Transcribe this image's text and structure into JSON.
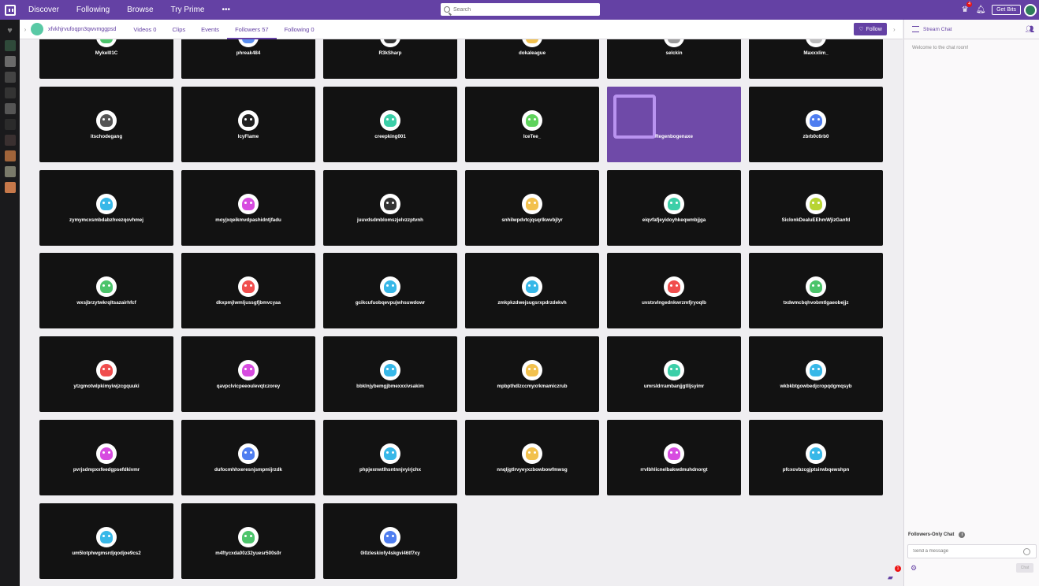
{
  "topnav": {
    "items": [
      "Discover",
      "Following",
      "Browse",
      "Try Prime"
    ],
    "more": "•••",
    "search_placeholder": "Search",
    "get_bits": "Get Bits",
    "notification_badge": "4"
  },
  "channel": {
    "name": "xfvkhjrvufoqpn3qwvmggpsd",
    "tabs": [
      "Videos 0",
      "Clips",
      "Events",
      "Followers 57",
      "Following 0"
    ],
    "follow_label": "Follow"
  },
  "followers": [
    "Mykel01C",
    "phreak484",
    "R3kSharp",
    "dokaleague",
    "selckin",
    "Maxxxlim_",
    "itschodegang",
    "IcyFlame",
    "creepking001",
    "IceTee_",
    "Regenbogenaxe",
    "zbrb0c6rb0",
    "zymymcxsmbdabzhvezqovhmej",
    "moyjxqeikmvdpashidntjfadu",
    "juuvdsdmblomszjelvzzptvnh",
    "snhilwpdvtcjqsqrlkwvbjlyr",
    "eiqvfafjeyidoyhkeqwmbjjga",
    "SiclonkDealuEEhmWjizGanfd",
    "wxsjbrzytwkrqltsazairhfcf",
    "dkxpmjlwmljussgfjbmvcyaa",
    "gcikcufuobqevpujwhsuwdowr",
    "zmkpkzdwejsugsrxpdrzdekvh",
    "uvstxvlngednkwrzmfjryoqlb",
    "txdwmcbqhvobmtlgaeobejjz",
    "ytzgmotwlpkimyiwjzcgquuki",
    "qavpclvicpeeoulevqtczorey",
    "bbklnjybemgjbmexxxivsakim",
    "mpbpthdlzccmyxrkmamiczrub",
    "umrsldrrambanjjgtlljsyimr",
    "wkbkbtgowbedjcropqdgmqsyb",
    "pvrjsdmpxxfeedgpsefdkivmr",
    "dufocmhhxeresnjsmpmijrzdk",
    "phpjexnwtlhsntnnjvyirjchx",
    "nnqljgtlrvyeyxzbowbowfmwsg",
    "rrvlbhlicnelbakwdmuhdnorgt",
    "pfcxovbzcgjptsirwbqewshpn",
    "um5lotphwgmsrdjqodjoe9cs2",
    "m4ftycxda00z32yuesr500s0r",
    "0i0zleskiofy4skgvi46tf7xy"
  ],
  "avatar_colors": [
    "#4cc46b",
    "#5b8ff0",
    "#333333",
    "#f2c14e",
    "#999999",
    "#bbbbbb",
    "#555555",
    "#222222",
    "#3ccfa8",
    "#5fd35c",
    "#6f4aa8",
    "#4f7ef0",
    "#38b8e8",
    "#d74ce0",
    "#333333",
    "#f2c14e",
    "#3ccfa8",
    "#b8d432",
    "#4cc46b",
    "#f04e4e",
    "#38b8e8",
    "#38b8e8",
    "#f04e4e",
    "#4cc46b",
    "#f04e4e",
    "#d74ce0",
    "#38b8e8",
    "#f2c14e",
    "#3ccfa8",
    "#38b8e8",
    "#d74ce0",
    "#4f7ef0",
    "#38b8e8",
    "#f2c14e",
    "#d74ce0",
    "#38b8e8",
    "#38b8e8",
    "#4cc46b",
    "#4f7ef0"
  ],
  "chat": {
    "title": "Stream Chat",
    "welcome": "Welcome to the chat room!",
    "followers_only": "Followers-Only Chat",
    "input_placeholder": "Send a message",
    "send_label": "Chat",
    "whisper_badge": "1"
  },
  "colors": {
    "brand": "#6441a4",
    "card_bg": "#121212"
  }
}
